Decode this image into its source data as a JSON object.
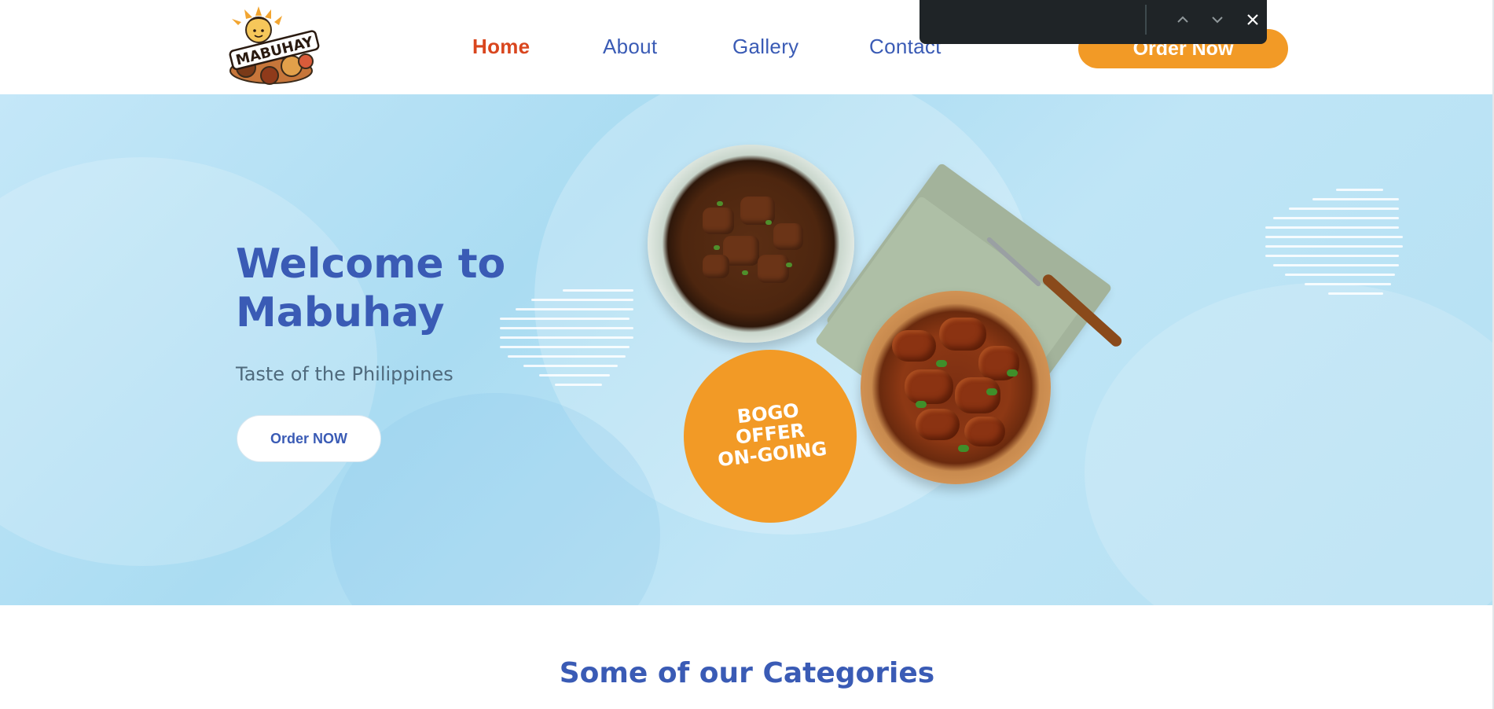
{
  "brand": {
    "logo_text": "MABUHAY",
    "colors": {
      "primary": "#3a5bb5",
      "accent": "#f29a26",
      "active": "#d9461e",
      "hero_bg": "#b4e0f3"
    }
  },
  "nav": {
    "items": [
      {
        "label": "Home",
        "active": true
      },
      {
        "label": "About",
        "active": false
      },
      {
        "label": "Gallery",
        "active": false
      },
      {
        "label": "Contact",
        "active": false
      }
    ],
    "cta_label": "Order Now"
  },
  "findbar": {
    "input_value": "",
    "prev_icon": "chevron-up-icon",
    "next_icon": "chevron-down-icon",
    "close_icon": "close-icon"
  },
  "hero": {
    "title_line1": "Welcome to",
    "title_line2": "Mabuhay",
    "subtitle": "Taste of the Philippines",
    "button_label": "Order NOW",
    "badge": {
      "line1": "BOGO",
      "line2": "OFFER",
      "line3": "ON-GOING"
    }
  },
  "categories": {
    "title": "Some of our Categories"
  }
}
